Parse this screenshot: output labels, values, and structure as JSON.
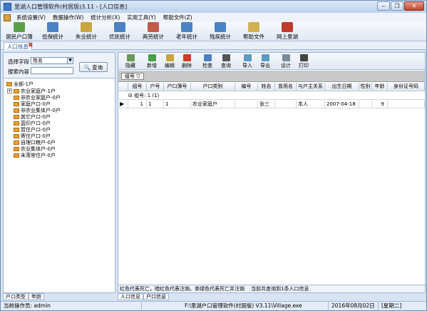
{
  "window": {
    "title": "里湖人口管理软件(村居版)3.11 - [人口信息]"
  },
  "menu": [
    "系统设置(V)",
    "数据操作(W)",
    "统计分析(X)",
    "实用工具(Y)",
    "帮助文件(Z)"
  ],
  "toolbar": [
    "居民户口簿",
    "低保统计",
    "失业统计",
    "优抚统计",
    "两劳统计",
    "老年统计",
    "残疾统计",
    "帮助文件",
    "网上里湖"
  ],
  "doc_tab": {
    "label": "人口信息"
  },
  "search": {
    "field_label": "选择字段",
    "field_value": "姓名",
    "content_label": "搜索内容",
    "content_value": "",
    "query_label": "查询"
  },
  "tree": {
    "root": "全部-1户",
    "items": [
      "农业家庭户-1户",
      "非农业家庭户-0户",
      "家庭户口-0户",
      "非农业集体户-0户",
      "其它户口-0户",
      "蓝印户口-0户",
      "暂住户口-0户",
      "寄住户口-0户",
      "自理口粮户-0户",
      "农业集体户-0户",
      "未落常住户-0户"
    ]
  },
  "left_tabs": [
    "户口类型",
    "年龄"
  ],
  "right_toolbar": [
    "隐藏",
    "新增",
    "编辑",
    "删除",
    "检查",
    "查询",
    "导入",
    "导出",
    "设计",
    "打印"
  ],
  "group_chip": "组号",
  "columns": [
    "组号",
    "户号",
    "户口簿号",
    "户口类别",
    "编号",
    "姓名",
    "曾用名",
    "与户主关系",
    "出生日期",
    "性别",
    "年龄",
    "身份证号码"
  ],
  "group_row": "组号: 1 (1)",
  "rows": [
    [
      "1",
      "1",
      "1",
      "农业家庭户",
      "",
      "张三",
      "",
      "本人",
      "2007-04-18",
      "",
      "9",
      ""
    ]
  ],
  "legend_text": "红色代表死亡，暗红色代表注销，茶绿色代表死亡并注销",
  "result_text": "当前共查询到1条人口信息",
  "right_tabs": [
    "人口信息",
    "户口信息"
  ],
  "status": {
    "operator": "当前操作员: admin",
    "path": "F:\\里湖户口管理软件(村居版) V3.11\\Village.exe",
    "date": "2016年08月02日",
    "weekday": "[星期二]"
  }
}
